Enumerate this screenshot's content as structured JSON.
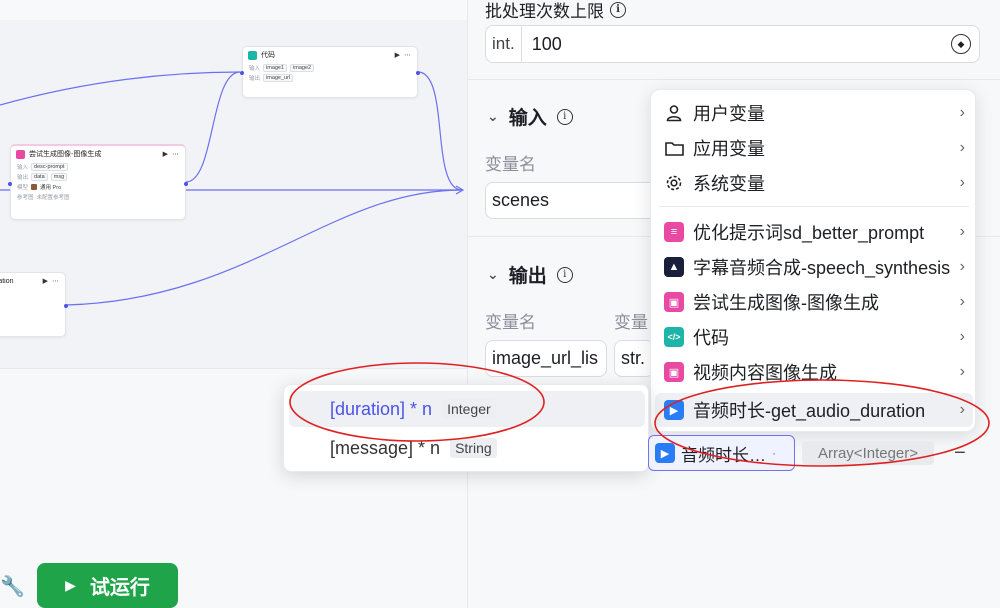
{
  "canvas": {
    "nodes": {
      "code": {
        "title": "代码",
        "input_label": "输入",
        "output_label": "输出",
        "inputs": [
          "image1",
          "image2"
        ],
        "outputs": [
          "image_url"
        ]
      },
      "image_gen": {
        "title": "尝试生成图像-图像生成",
        "input_label": "输入",
        "output_label": "输出",
        "model_label": "模型",
        "inputs": [
          "desc-prompt"
        ],
        "outputs": [
          "data",
          "msg"
        ],
        "model": "通用 Pro",
        "extra_label": "参考图",
        "extra_value": "未配置参考图"
      },
      "duration": {
        "title": "ration"
      }
    }
  },
  "panel": {
    "batch_limit": {
      "label": "批处理次数上限",
      "type": "int.",
      "value": "100"
    },
    "input_section": {
      "title": "输入",
      "var_name_label": "变量名",
      "var_name_value": "scenes"
    },
    "output_section": {
      "title": "输出",
      "var_name_label": "变量名",
      "var_value_label": "变量",
      "var_name_value": "image_url_lis",
      "type_value": "str."
    }
  },
  "var_menu": {
    "items": [
      {
        "label": "用户变量",
        "icon": "user-icon"
      },
      {
        "label": "应用变量",
        "icon": "folder-icon"
      },
      {
        "label": "系统变量",
        "icon": "gear-icon"
      },
      {
        "label": "优化提示词sd_better_prompt",
        "icon": "prompt-icon",
        "color": "#e84aa3"
      },
      {
        "label": "字幕音频合成-speech_synthesis",
        "icon": "speech-icon",
        "color": "#1a1f3a"
      },
      {
        "label": "尝试生成图像-图像生成",
        "icon": "image-icon",
        "color": "#e84aa3"
      },
      {
        "label": "代码",
        "icon": "code-icon",
        "color": "#1cb5a8"
      },
      {
        "label": "视频内容图像生成",
        "icon": "image-icon",
        "color": "#e84aa3"
      },
      {
        "label": "音频时长-get_audio_duration",
        "icon": "audio-icon",
        "color": "#2a7cf6"
      }
    ]
  },
  "sub_menu": {
    "items": [
      {
        "label": "[duration] * n",
        "type": "Integer"
      },
      {
        "label": "[message] * n",
        "type": "String"
      }
    ]
  },
  "selected_ref": {
    "label": "音频时长…",
    "type": "Array<Integer>"
  },
  "toolbar": {
    "run_label": "试运行"
  },
  "colors": {
    "accent": "#4d53e8",
    "run_green": "#20a44a",
    "annotation_red": "#e02020"
  }
}
